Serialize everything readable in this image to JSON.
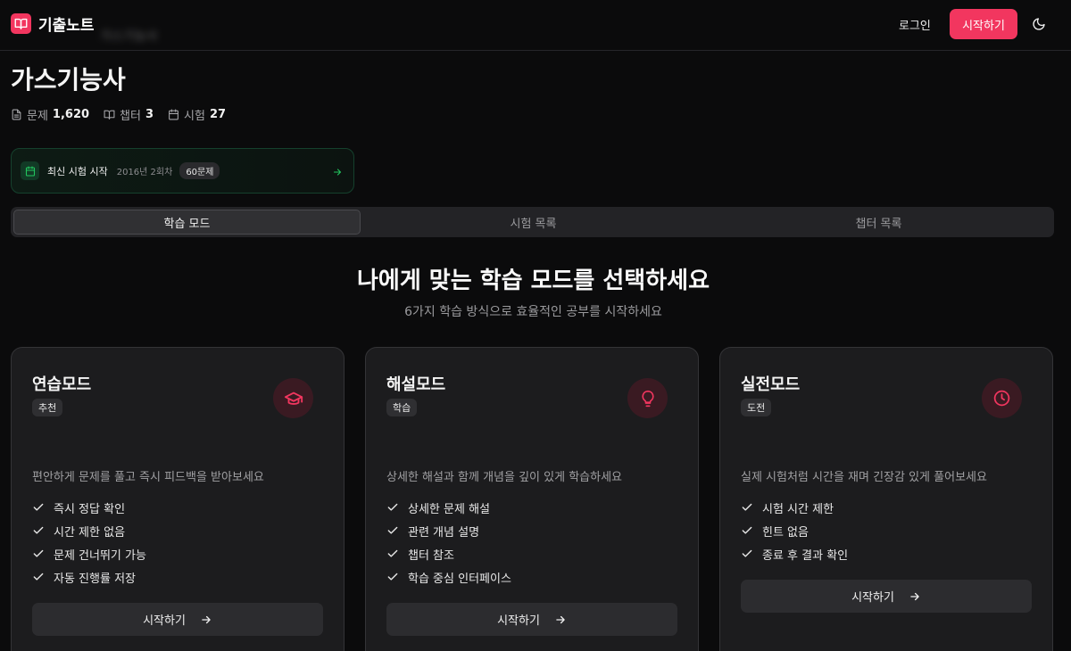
{
  "header": {
    "logo_text": "기출노트",
    "blurred_text": "가스기능사",
    "login_label": "로그인",
    "start_label": "시작하기"
  },
  "page": {
    "title": "가스기능사",
    "stats": [
      {
        "label": "문제",
        "value": "1,620"
      },
      {
        "label": "챕터",
        "value": "3"
      },
      {
        "label": "시험",
        "value": "27"
      }
    ]
  },
  "latest_exam": {
    "label": "최신 시험 시작",
    "subtitle": "2016년 2회차",
    "badge": "60문제"
  },
  "tabs": [
    "학습 모드",
    "시험 목록",
    "챕터 목록"
  ],
  "section": {
    "title": "나에게 맞는 학습 모드를 선택하세요",
    "subtitle": "6가지 학습 방식으로 효율적인 공부를 시작하세요"
  },
  "cards": [
    {
      "title": "연습모드",
      "badge": "추천",
      "icon": "graduation-cap-icon",
      "description": "편안하게 문제를 풀고 즉시 피드백을 받아보세요",
      "features": [
        "즉시 정답 확인",
        "시간 제한 없음",
        "문제 건너뛰기 가능",
        "자동 진행률 저장"
      ],
      "button": "시작하기"
    },
    {
      "title": "해설모드",
      "badge": "학습",
      "icon": "lightbulb-icon",
      "description": "상세한 해설과 함께 개념을 깊이 있게 학습하세요",
      "features": [
        "상세한 문제 해설",
        "관련 개념 설명",
        "챕터 참조",
        "학습 중심 인터페이스"
      ],
      "button": "시작하기"
    },
    {
      "title": "실전모드",
      "badge": "도전",
      "icon": "clock-icon",
      "description": "실제 시험처럼 시간을 재며 긴장감 있게 풀어보세요",
      "features": [
        "시험 시간 제한",
        "힌트 없음",
        "종료 후 결과 확인"
      ],
      "button": "시작하기"
    }
  ],
  "colors": {
    "accent": "#f2365f",
    "background": "#0b0b0c",
    "card": "#1c1c1e",
    "success": "#22c55e"
  }
}
